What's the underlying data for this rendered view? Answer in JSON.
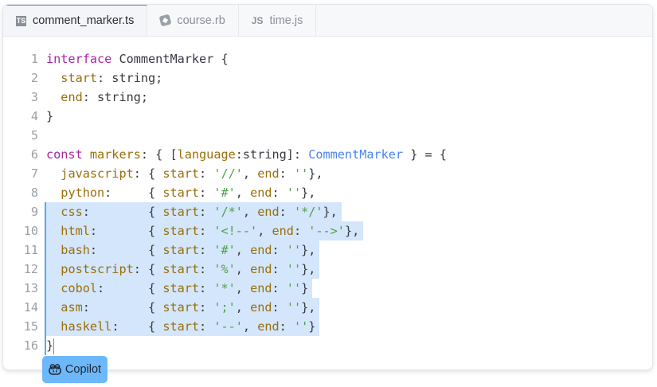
{
  "tabs": [
    {
      "label": "comment_marker.ts",
      "icon": "TS",
      "active": true
    },
    {
      "label": "course.rb",
      "icon": "◆",
      "active": false
    },
    {
      "label": "time.js",
      "icon": "JS",
      "active": false
    }
  ],
  "selected_lines": [
    9,
    10,
    11,
    12,
    13,
    14,
    15
  ],
  "code": [
    [
      [
        "interface",
        "k"
      ],
      [
        " CommentMarker {",
        ""
      ]
    ],
    [
      [
        "  ",
        ""
      ],
      [
        "start",
        "p"
      ],
      [
        ": string;",
        ""
      ]
    ],
    [
      [
        "  ",
        ""
      ],
      [
        "end",
        "p"
      ],
      [
        ": string;",
        ""
      ]
    ],
    [
      [
        "}",
        ""
      ]
    ],
    [],
    [
      [
        "const",
        "k"
      ],
      [
        " ",
        ""
      ],
      [
        "markers",
        "p"
      ],
      [
        ": { [",
        ""
      ],
      [
        "language",
        "p"
      ],
      [
        ":string]: ",
        ""
      ],
      [
        "CommentMarker",
        "t"
      ],
      [
        " } = {",
        ""
      ]
    ],
    [
      [
        "  ",
        ""
      ],
      [
        "javascript",
        "p"
      ],
      [
        ": { ",
        ""
      ],
      [
        "start",
        "p"
      ],
      [
        ": ",
        ""
      ],
      [
        "'//'",
        "s"
      ],
      [
        ", ",
        ""
      ],
      [
        "end",
        "p"
      ],
      [
        ": ",
        ""
      ],
      [
        "''",
        "s"
      ],
      [
        "},",
        ""
      ]
    ],
    [
      [
        "  ",
        ""
      ],
      [
        "python",
        "p"
      ],
      [
        ":     { ",
        ""
      ],
      [
        "start",
        "p"
      ],
      [
        ": ",
        ""
      ],
      [
        "'#'",
        "s"
      ],
      [
        ", ",
        ""
      ],
      [
        "end",
        "p"
      ],
      [
        ": ",
        ""
      ],
      [
        "''",
        "s"
      ],
      [
        "},",
        ""
      ]
    ],
    [
      [
        "  ",
        ""
      ],
      [
        "css",
        "p"
      ],
      [
        ":        { ",
        ""
      ],
      [
        "start",
        "p"
      ],
      [
        ": ",
        ""
      ],
      [
        "'/*'",
        "s"
      ],
      [
        ", ",
        ""
      ],
      [
        "end",
        "p"
      ],
      [
        ": ",
        ""
      ],
      [
        "'*/'",
        "s"
      ],
      [
        "},",
        ""
      ]
    ],
    [
      [
        "  ",
        ""
      ],
      [
        "html",
        "p"
      ],
      [
        ":       { ",
        ""
      ],
      [
        "start",
        "p"
      ],
      [
        ": ",
        ""
      ],
      [
        "'<!--'",
        "s"
      ],
      [
        ", ",
        ""
      ],
      [
        "end",
        "p"
      ],
      [
        ": ",
        ""
      ],
      [
        "'-->'",
        "s"
      ],
      [
        "},",
        ""
      ]
    ],
    [
      [
        "  ",
        ""
      ],
      [
        "bash",
        "p"
      ],
      [
        ":       { ",
        ""
      ],
      [
        "start",
        "p"
      ],
      [
        ": ",
        ""
      ],
      [
        "'#'",
        "s"
      ],
      [
        ", ",
        ""
      ],
      [
        "end",
        "p"
      ],
      [
        ": ",
        ""
      ],
      [
        "''",
        "s"
      ],
      [
        "},",
        ""
      ]
    ],
    [
      [
        "  ",
        ""
      ],
      [
        "postscript",
        "p"
      ],
      [
        ": { ",
        ""
      ],
      [
        "start",
        "p"
      ],
      [
        ": ",
        ""
      ],
      [
        "'%'",
        "s"
      ],
      [
        ", ",
        ""
      ],
      [
        "end",
        "p"
      ],
      [
        ": ",
        ""
      ],
      [
        "''",
        "s"
      ],
      [
        "},",
        ""
      ]
    ],
    [
      [
        "  ",
        ""
      ],
      [
        "cobol",
        "p"
      ],
      [
        ":      { ",
        ""
      ],
      [
        "start",
        "p"
      ],
      [
        ": ",
        ""
      ],
      [
        "'*'",
        "s"
      ],
      [
        ", ",
        ""
      ],
      [
        "end",
        "p"
      ],
      [
        ": ",
        ""
      ],
      [
        "''",
        "s"
      ],
      [
        "}",
        ""
      ]
    ],
    [
      [
        "  ",
        ""
      ],
      [
        "asm",
        "p"
      ],
      [
        ":        { ",
        ""
      ],
      [
        "start",
        "p"
      ],
      [
        ": ",
        ""
      ],
      [
        "';'",
        "s"
      ],
      [
        ", ",
        ""
      ],
      [
        "end",
        "p"
      ],
      [
        ": ",
        ""
      ],
      [
        "''",
        "s"
      ],
      [
        "},",
        ""
      ]
    ],
    [
      [
        "  ",
        ""
      ],
      [
        "haskell",
        "p"
      ],
      [
        ":    { ",
        ""
      ],
      [
        "start",
        "p"
      ],
      [
        ": ",
        ""
      ],
      [
        "'--'",
        "s"
      ],
      [
        ", ",
        ""
      ],
      [
        "end",
        "p"
      ],
      [
        ": ",
        ""
      ],
      [
        "''",
        "s"
      ],
      [
        "}",
        ""
      ]
    ],
    [
      [
        "}",
        ""
      ]
    ]
  ],
  "copilot": {
    "label": "Copilot"
  }
}
